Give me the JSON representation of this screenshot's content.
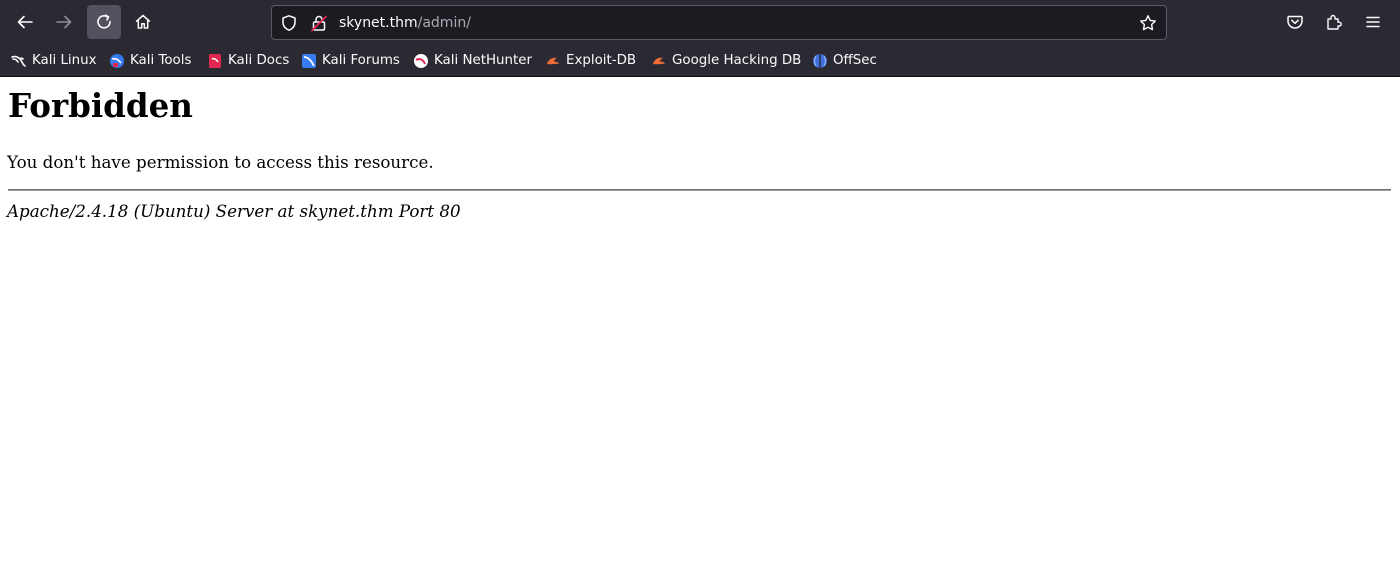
{
  "browser": {
    "toolbar": {
      "back_icon": "arrow-left-icon",
      "forward_icon": "arrow-right-icon",
      "reload_icon": "reload-icon",
      "home_icon": "home-icon",
      "pocket_icon": "pocket-icon",
      "extensions_icon": "puzzle-icon",
      "menu_icon": "hamburger-menu-icon"
    },
    "urlbar": {
      "host": "skynet.thm",
      "path": "/admin/",
      "shield_icon": "tracking-protection-shield-icon",
      "lock_icon": "insecure-lock-icon",
      "bookmark_icon": "star-icon"
    },
    "bookmarks": [
      {
        "label": "Kali Linux",
        "icon": "kali-dragon-icon"
      },
      {
        "label": "Kali Tools",
        "icon": "kali-tools-icon"
      },
      {
        "label": "Kali Docs",
        "icon": "kali-docs-icon"
      },
      {
        "label": "Kali Forums",
        "icon": "kali-forums-icon"
      },
      {
        "label": "Kali NetHunter",
        "icon": "kali-nethunter-icon"
      },
      {
        "label": "Exploit-DB",
        "icon": "exploit-db-icon"
      },
      {
        "label": "Google Hacking DB",
        "icon": "ghdb-icon"
      },
      {
        "label": "OffSec",
        "icon": "offsec-icon"
      }
    ]
  },
  "page": {
    "heading": "Forbidden",
    "message": "You don't have permission to access this resource.",
    "server_signature": "Apache/2.4.18 (Ubuntu) Server at skynet.thm Port 80"
  },
  "colors": {
    "chrome_bg": "#2b2a33",
    "urlbar_bg": "#1c1b22",
    "text_light": "#fbfbfe",
    "text_muted": "#a9a9b2",
    "page_bg": "#ffffff"
  }
}
